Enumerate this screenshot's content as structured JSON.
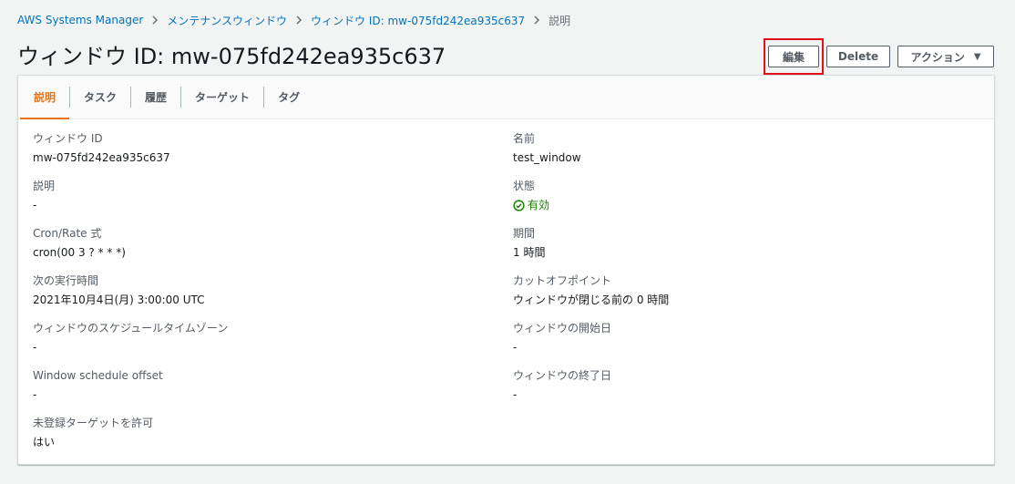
{
  "breadcrumb": {
    "items": [
      "AWS Systems Manager",
      "メンテナンスウィンドウ",
      "ウィンドウ ID: mw-075fd242ea935c637"
    ],
    "current": "説明"
  },
  "page": {
    "title": "ウィンドウ ID: mw-075fd242ea935c637"
  },
  "header_buttons": {
    "edit": "編集",
    "delete": "Delete",
    "actions": "アクション"
  },
  "tabs": [
    {
      "label": "説明",
      "active": true
    },
    {
      "label": "タスク"
    },
    {
      "label": "履歴"
    },
    {
      "label": "ターゲット"
    },
    {
      "label": "タグ"
    }
  ],
  "details": {
    "left": [
      {
        "label": "ウィンドウ ID",
        "value": "mw-075fd242ea935c637"
      },
      {
        "label": "説明",
        "value": "-"
      },
      {
        "label": "Cron/Rate 式",
        "value": "cron(00 3 ? * * *)"
      },
      {
        "label": "次の実行時間",
        "value": "2021年10月4日(月) 3:00:00 UTC"
      },
      {
        "label": "ウィンドウのスケジュールタイムゾーン",
        "value": "-"
      },
      {
        "label": "Window schedule offset",
        "value": "-"
      },
      {
        "label": "未登録ターゲットを許可",
        "value": "はい"
      }
    ],
    "right": [
      {
        "label": "名前",
        "value": "test_window"
      },
      {
        "label": "状態",
        "value": "有効",
        "icon": "check-circle-icon"
      },
      {
        "label": "期間",
        "value": "1 時間"
      },
      {
        "label": "カットオフポイント",
        "value": "ウィンドウが閉じる前の 0 時間"
      },
      {
        "label": "ウィンドウの開始日",
        "value": "-"
      },
      {
        "label": "ウィンドウの終了日",
        "value": "-"
      }
    ]
  },
  "colors": {
    "link": "#0073bb",
    "active_tab": "#ec7211",
    "status_success": "#1d8102",
    "highlight_border": "#e3101a"
  }
}
